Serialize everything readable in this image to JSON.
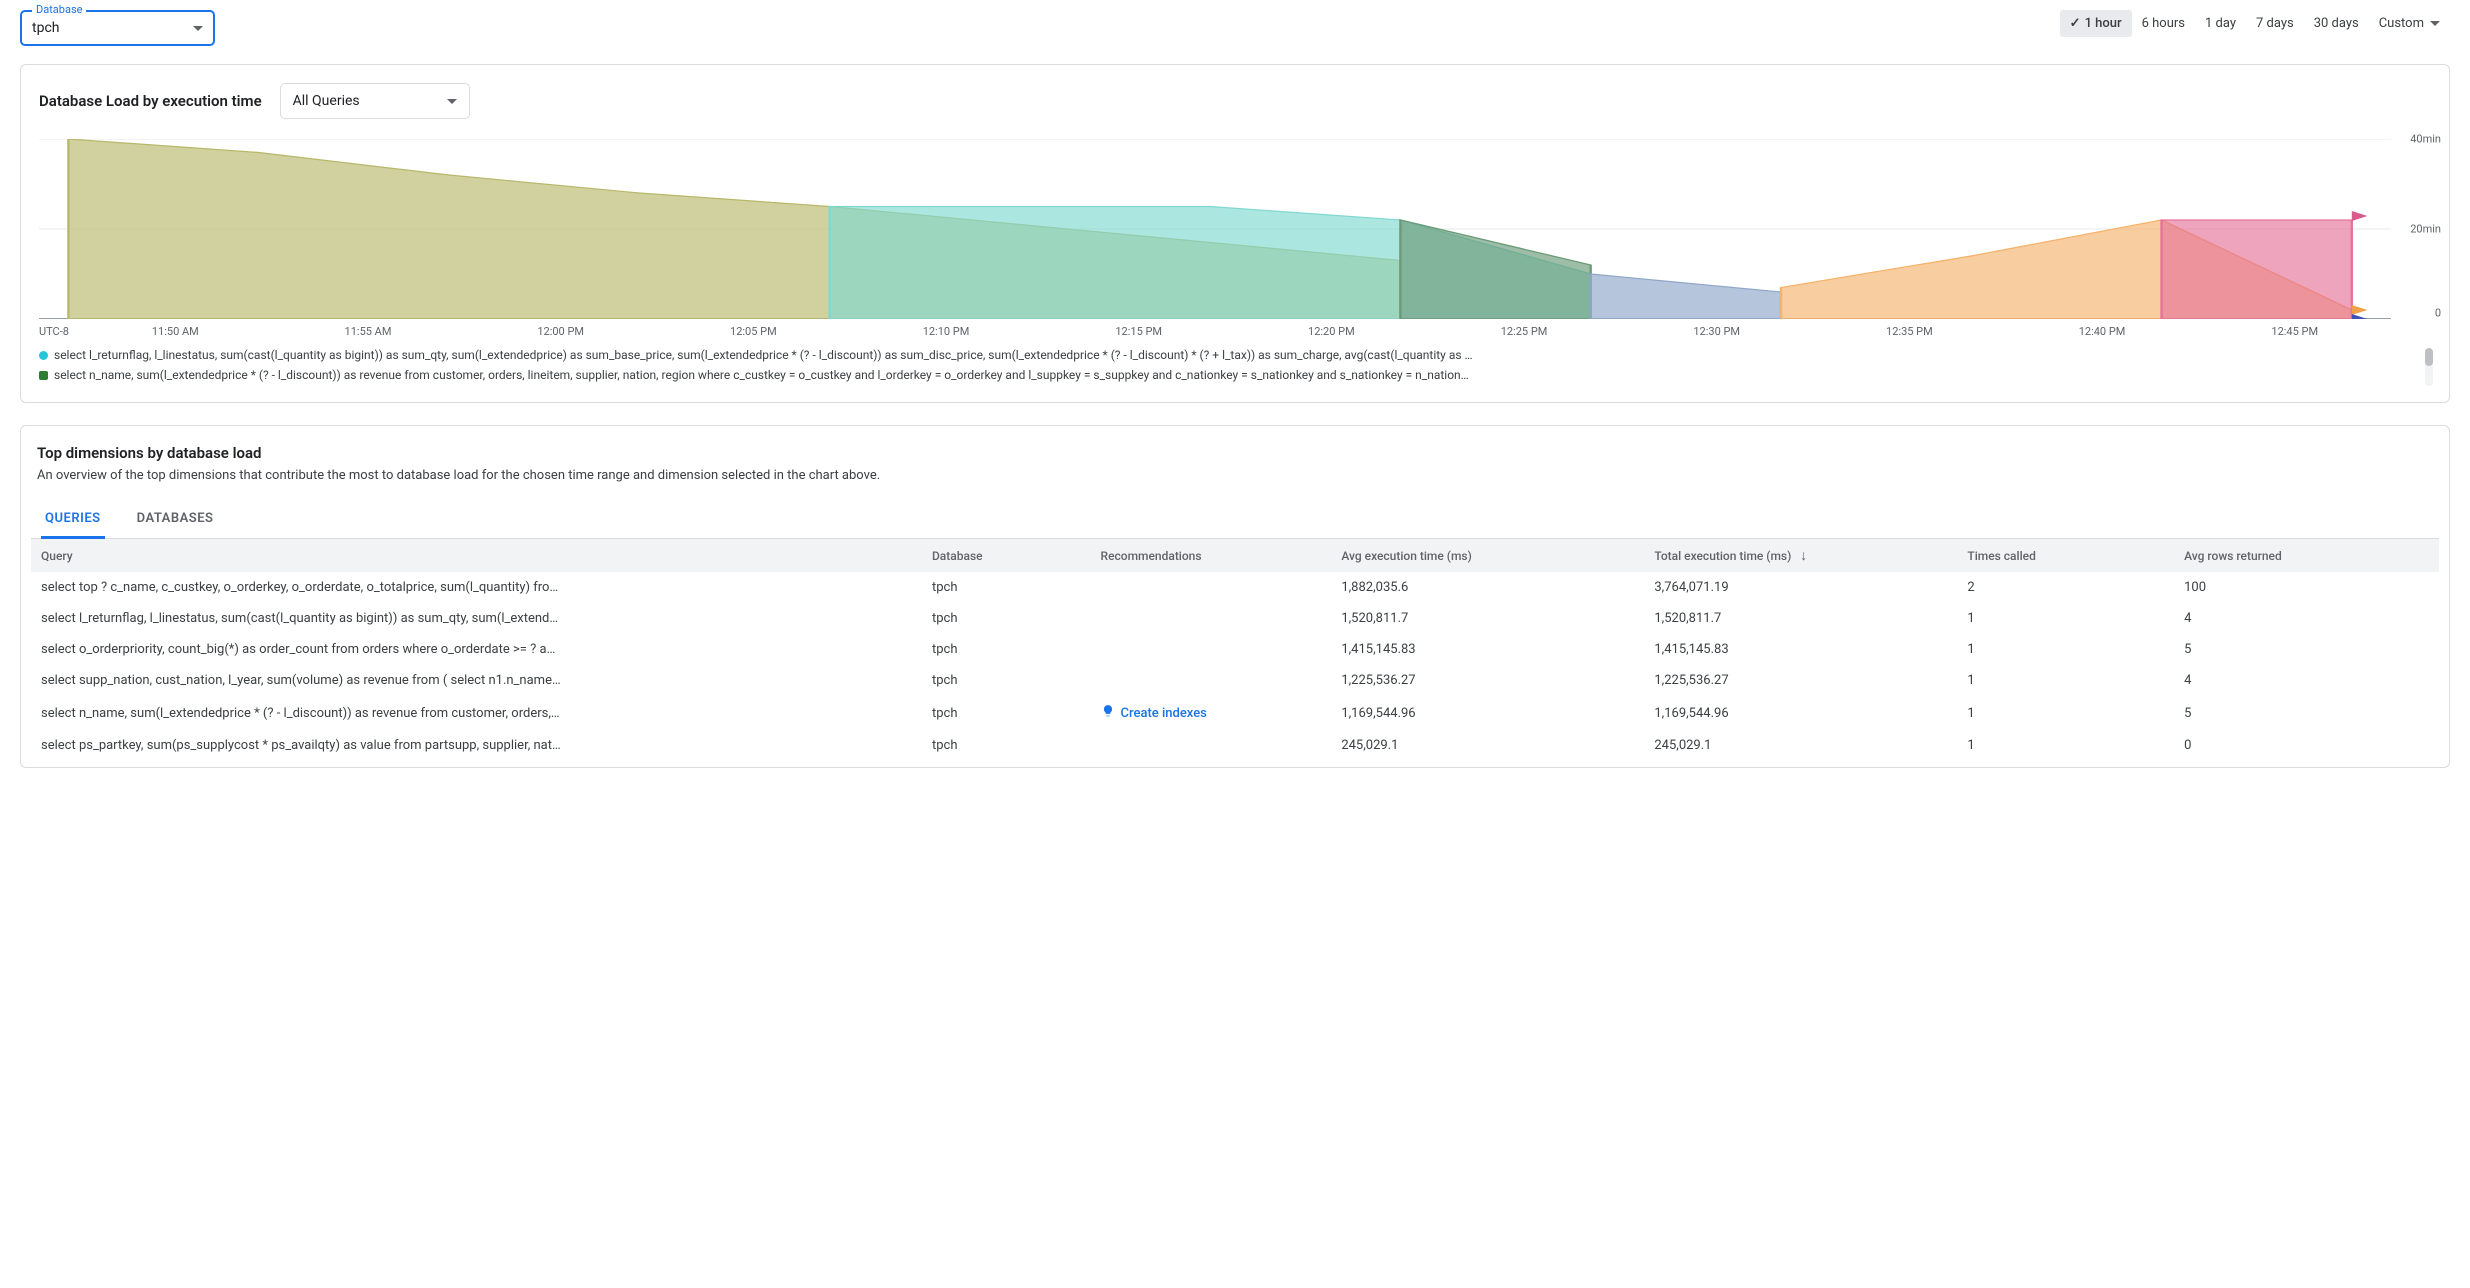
{
  "database_selector": {
    "label": "Database",
    "value": "tpch"
  },
  "time_ranges": {
    "items": [
      "1 hour",
      "6 hours",
      "1 day",
      "7 days",
      "30 days"
    ],
    "active_index": 0,
    "custom_label": "Custom"
  },
  "load_chart": {
    "title": "Database Load by execution time",
    "filter_value": "All Queries",
    "timezone_label": "UTC-8",
    "x_ticks": [
      "11:50 AM",
      "11:55 AM",
      "12:00 PM",
      "12:05 PM",
      "12:10 PM",
      "12:15 PM",
      "12:20 PM",
      "12:25 PM",
      "12:30 PM",
      "12:35 PM",
      "12:40 PM",
      "12:45 PM"
    ],
    "y_ticks": [
      "40min",
      "20min",
      "0"
    ],
    "legend": [
      {
        "color": "#26c6da",
        "shape": "circle",
        "text": "select l_returnflag, l_linestatus, sum(cast(l_quantity as bigint)) as sum_qty, sum(l_extendedprice) as sum_base_price, sum(l_extendedprice * (? - l_discount)) as sum_disc_price, sum(l_extendedprice * (? - l_discount) * (? + l_tax)) as sum_charge, avg(cast(l_quantity as …"
      },
      {
        "color": "#2e7d32",
        "shape": "square",
        "text": "select n_name, sum(l_extendedprice * (? - l_discount)) as revenue from customer, orders, lineitem, supplier, nation, region where c_custkey = o_custkey and l_orderkey = o_orderkey and l_suppkey = s_suppkey and c_nationkey = s_nationkey and s_nationkey = n_nation…"
      }
    ]
  },
  "chart_data": {
    "type": "area",
    "xlabel": "",
    "ylabel": "",
    "ylim": [
      0,
      40
    ],
    "y_unit": "min",
    "categories": [
      "11:47 AM",
      "11:50 AM",
      "11:55 AM",
      "12:00 PM",
      "12:05 PM",
      "12:10 PM",
      "12:15 PM",
      "12:20 PM",
      "12:25 PM",
      "12:30 PM",
      "12:35 PM",
      "12:40 PM",
      "12:45 PM"
    ],
    "series": [
      {
        "name": "olive",
        "color": "#b8b86b",
        "values": [
          40,
          37,
          32,
          28,
          25,
          21,
          17,
          13,
          0,
          0,
          0,
          0,
          0
        ]
      },
      {
        "name": "teal",
        "color": "#7fd9d0",
        "values": [
          0,
          0,
          0,
          0,
          25,
          25,
          25,
          22,
          10,
          0,
          0,
          0,
          0
        ]
      },
      {
        "name": "green",
        "color": "#6a9a77",
        "values": [
          0,
          0,
          0,
          0,
          0,
          0,
          0,
          22,
          12,
          0,
          0,
          0,
          0
        ]
      },
      {
        "name": "blue",
        "color": "#8ea6c8",
        "values": [
          0,
          0,
          0,
          0,
          0,
          0,
          0,
          0,
          10,
          6,
          0,
          0,
          0
        ]
      },
      {
        "name": "orange",
        "color": "#f5b26b",
        "values": [
          0,
          0,
          0,
          0,
          0,
          0,
          0,
          0,
          0,
          7,
          14,
          22,
          2
        ]
      },
      {
        "name": "pink",
        "color": "#e57399",
        "values": [
          0,
          0,
          0,
          0,
          0,
          0,
          0,
          0,
          0,
          0,
          0,
          22,
          22
        ]
      }
    ]
  },
  "dimensions_section": {
    "title": "Top dimensions by database load",
    "subtitle": "An overview of the top dimensions that contribute the most to database load for the chosen time range and dimension selected in the chart above.",
    "tabs": [
      "QUERIES",
      "DATABASES"
    ],
    "active_tab_index": 0,
    "columns": {
      "query": "Query",
      "database": "Database",
      "recommendations": "Recommendations",
      "avg_exec": "Avg execution time (ms)",
      "total_exec": "Total execution time (ms)",
      "times_called": "Times called",
      "avg_rows": "Avg rows returned"
    },
    "sorted_column": "total_exec",
    "sort_dir": "desc",
    "recommendation_label": "Create indexes",
    "rows": [
      {
        "query": "select top ? c_name, c_custkey, o_orderkey, o_orderdate, o_totalprice, sum(l_quantity) fro…",
        "database": "tpch",
        "recommendation": "",
        "avg_exec": "1,882,035.6",
        "total_exec": "3,764,071.19",
        "times_called": "2",
        "avg_rows": "100"
      },
      {
        "query": "select l_returnflag, l_linestatus, sum(cast(l_quantity as bigint)) as sum_qty, sum(l_extend…",
        "database": "tpch",
        "recommendation": "",
        "avg_exec": "1,520,811.7",
        "total_exec": "1,520,811.7",
        "times_called": "1",
        "avg_rows": "4"
      },
      {
        "query": "select o_orderpriority, count_big(*) as order_count from orders where o_orderdate >= ? a…",
        "database": "tpch",
        "recommendation": "",
        "avg_exec": "1,415,145.83",
        "total_exec": "1,415,145.83",
        "times_called": "1",
        "avg_rows": "5"
      },
      {
        "query": "select supp_nation, cust_nation, l_year, sum(volume) as revenue from ( select n1.n_name…",
        "database": "tpch",
        "recommendation": "",
        "avg_exec": "1,225,536.27",
        "total_exec": "1,225,536.27",
        "times_called": "1",
        "avg_rows": "4"
      },
      {
        "query": "select n_name, sum(l_extendedprice * (? - l_discount)) as revenue from customer, orders,…",
        "database": "tpch",
        "recommendation": "Create indexes",
        "avg_exec": "1,169,544.96",
        "total_exec": "1,169,544.96",
        "times_called": "1",
        "avg_rows": "5"
      },
      {
        "query": "select ps_partkey, sum(ps_supplycost * ps_availqty) as value from partsupp, supplier, nat…",
        "database": "tpch",
        "recommendation": "",
        "avg_exec": "245,029.1",
        "total_exec": "245,029.1",
        "times_called": "1",
        "avg_rows": "0"
      }
    ]
  }
}
